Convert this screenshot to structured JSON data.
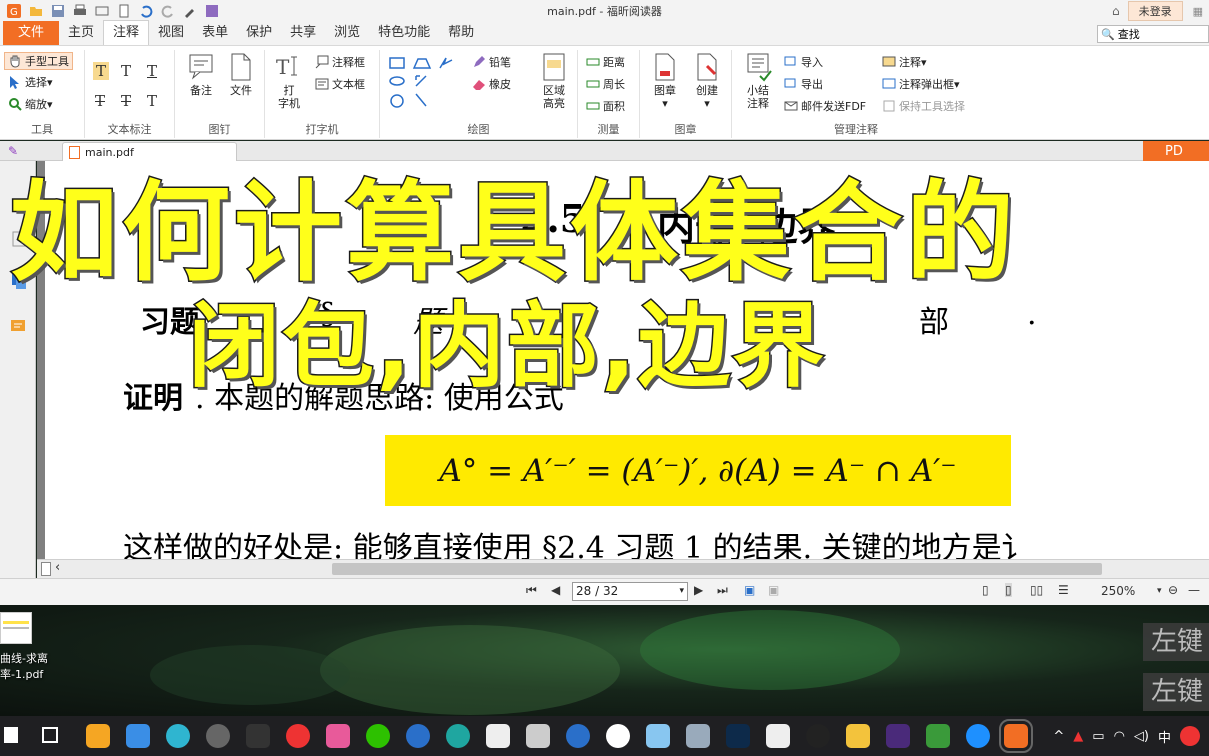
{
  "window": {
    "title": "main.pdf - 福昕阅读器",
    "login": "未登录"
  },
  "menu": [
    "文件",
    "主页",
    "注释",
    "视图",
    "表单",
    "保护",
    "共享",
    "浏览",
    "特色功能",
    "帮助"
  ],
  "menu_active": "注释",
  "search": {
    "value": "查找"
  },
  "ribbon": {
    "tools": {
      "hand": "手型工具",
      "select": "选择",
      "zoom": "缩放",
      "label": "工具"
    },
    "text_markup": {
      "label": "文本标注"
    },
    "pin": {
      "note": "备注",
      "file": "文件",
      "label": "图钉"
    },
    "typewriter": {
      "type": "打\n字机",
      "callout": "注释框",
      "textbox": "文本框",
      "label": "打字机"
    },
    "drawing": {
      "pencil": "铅笔",
      "eraser": "橡皮",
      "area_highlight": "区域\n高亮",
      "label": "绘图"
    },
    "measure": {
      "distance": "距离",
      "perimeter": "周长",
      "area": "面积",
      "label": "测量"
    },
    "stamp": {
      "stamp": "图章",
      "create": "创建",
      "label": "图章"
    },
    "manage": {
      "summarize": "小结\n注释",
      "import": "导入",
      "export": "导出",
      "email_fdf": "邮件发送FDF",
      "comments": "注释",
      "comments_popup": "注释弹出框",
      "keep_tool": "保持工具选择",
      "label": "管理注释"
    }
  },
  "doc_tab": {
    "name": "main.pdf",
    "right_label": "PD"
  },
  "page_content": {
    "heading_left": "2.5",
    "heading_right": "内部, 边界",
    "exercise_prefix": "习题",
    "exercise_mid": "§",
    "exercise_text": "题 1",
    "exercise_tail": "部",
    "exercise_end": ".",
    "proof_label": "证明",
    "proof_text": ". 本题的解题思路: 使用公式",
    "formula": "A° = A′⁻′ = (A′⁻)′,  ∂(A) = A⁻ ∩ A′⁻",
    "line3": "这样做的好处是: 能够直接使用 §2.4 习题 1 的结果. 关键的地方是讠"
  },
  "overlay": {
    "line1": "如何计算具体集合的",
    "line2": "闭包,内部,边界"
  },
  "status": {
    "page": "28 / 32",
    "zoom": "250%"
  },
  "desktop": {
    "file_name": "曲线-求离\n率-1.pdf",
    "key_hint_1": "左键",
    "key_hint_2": "左键"
  },
  "tray": {
    "ime": "中"
  },
  "colors": {
    "accent": "#f26e24",
    "highlight": "#ffea00",
    "overlay_text": "#ffff1a"
  }
}
